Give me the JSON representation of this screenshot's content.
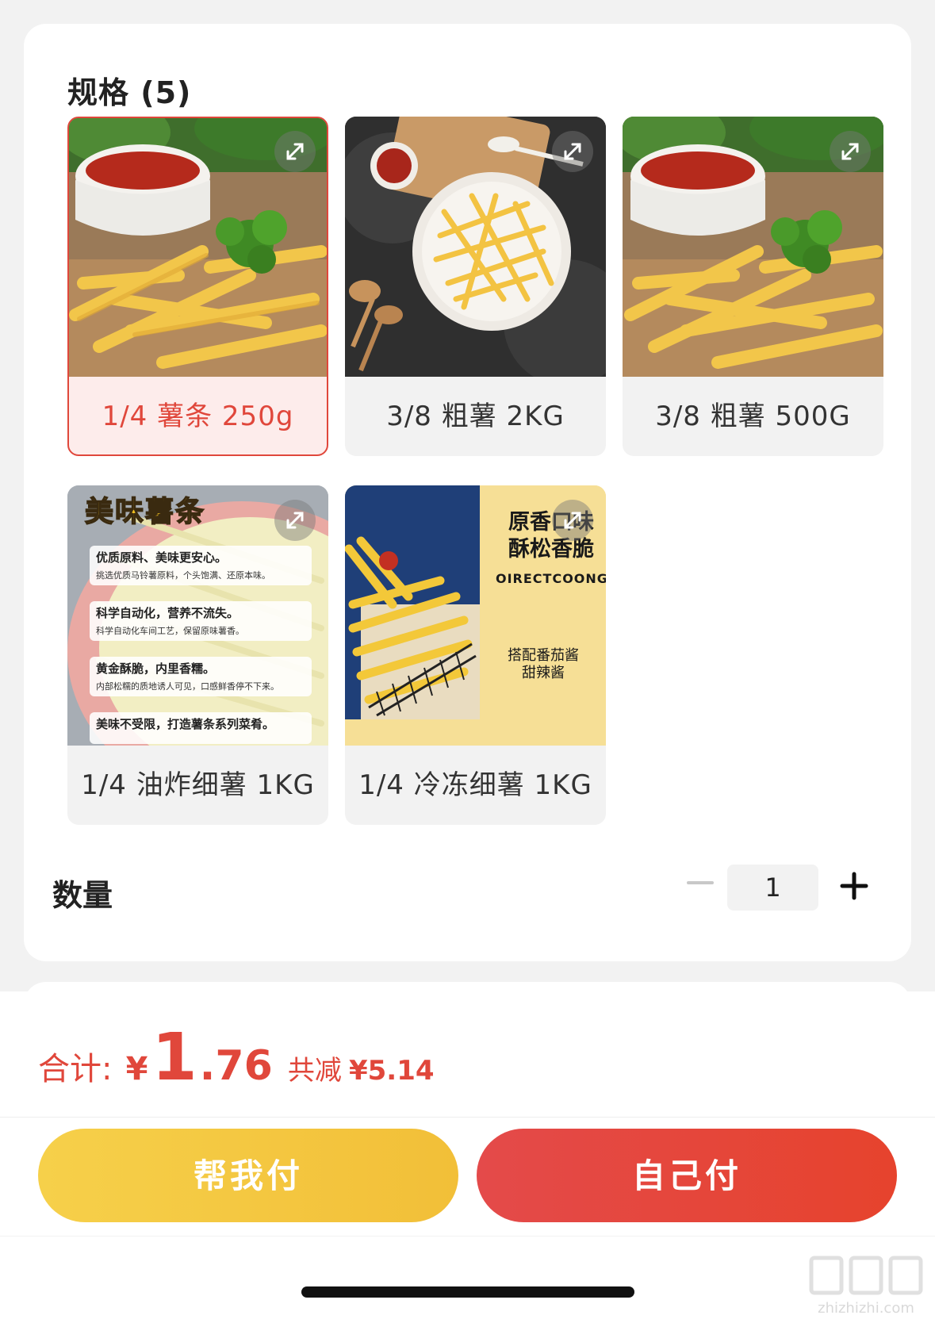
{
  "spec_section": {
    "title": "规格 (5)",
    "options": [
      {
        "label": "1/4 薯条 250g",
        "selected": true
      },
      {
        "label": "3/8 粗薯 2KG",
        "selected": false
      },
      {
        "label": "3/8 粗薯 500G",
        "selected": false
      },
      {
        "label": "1/4 油炸细薯 1KG",
        "selected": false,
        "image_text": {
          "headline": "美味薯条",
          "points": [
            {
              "title": "优质原料、美味更安心。",
              "desc": "挑选优质马铃薯原料，个头饱满、还原本味。"
            },
            {
              "title": "科学自动化，营养不流失。",
              "desc": "科学自动化车间工艺，保留原味薯香。"
            },
            {
              "title": "黄金酥脆，内里香糯。",
              "desc": "内部松糯的质地诱人可见，口感鲜香停不下来。"
            },
            {
              "title": "美味不受限，打造薯条系列菜肴。",
              "desc": ""
            }
          ]
        }
      },
      {
        "label": "1/4 冷冻细薯 1KG",
        "selected": false,
        "image_text": {
          "line1": "原香口味",
          "line2": "酥松香脆",
          "brand": "OIRECTCOONG",
          "sauce1": "搭配番茄酱",
          "sauce2": "甜辣酱"
        }
      }
    ]
  },
  "quantity": {
    "label": "数量",
    "value": "1"
  },
  "summary": {
    "total_label": "合计:",
    "currency": "¥",
    "price_int": "1",
    "price_dec": ".76",
    "saving_label": "共减",
    "saving_value": "¥5.14"
  },
  "actions": {
    "help_pay": "帮我付",
    "self_pay": "自己付"
  },
  "watermark": {
    "text": "zhizhizhi.com"
  },
  "colors": {
    "accent_red": "#e0473b",
    "help_button_yellow": "#f2bf38",
    "self_button_red": "#e4463a",
    "background": "#f2f2f2"
  },
  "icons": {
    "expand": "expand-arrows-icon",
    "minus": "minus-icon",
    "plus": "plus-icon"
  }
}
